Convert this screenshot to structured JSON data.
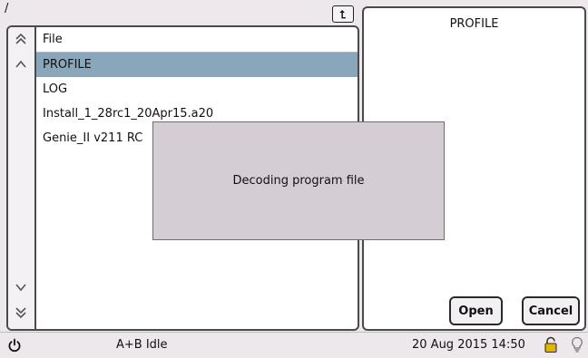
{
  "path": "/",
  "file_list": {
    "header": "File",
    "items": [
      {
        "name": "PROFILE",
        "selected": true
      },
      {
        "name": "LOG",
        "selected": false
      },
      {
        "name": "Install_1_28rc1_20Apr15.a20",
        "selected": false
      },
      {
        "name": "Genie_II v211 RC",
        "selected": false
      }
    ]
  },
  "preview": {
    "title": "PROFILE",
    "open_label": "Open",
    "cancel_label": "Cancel"
  },
  "dialog": {
    "message": "Decoding program file"
  },
  "status": {
    "text": "A+B Idle",
    "datetime": "20 Aug 2015 14:50"
  },
  "icons": {
    "up_folder": "up-folder-icon",
    "scroll_top": "double-chevron-up-icon",
    "scroll_up": "chevron-up-icon",
    "scroll_down": "chevron-down-icon",
    "scroll_bottom": "double-chevron-down-icon",
    "power": "power-icon",
    "lock": "lock-icon",
    "bulb": "lightbulb-icon"
  },
  "colors": {
    "selection": "#8aa6ba",
    "dialog": "#d4cdd4",
    "lock": "#e0b400"
  }
}
